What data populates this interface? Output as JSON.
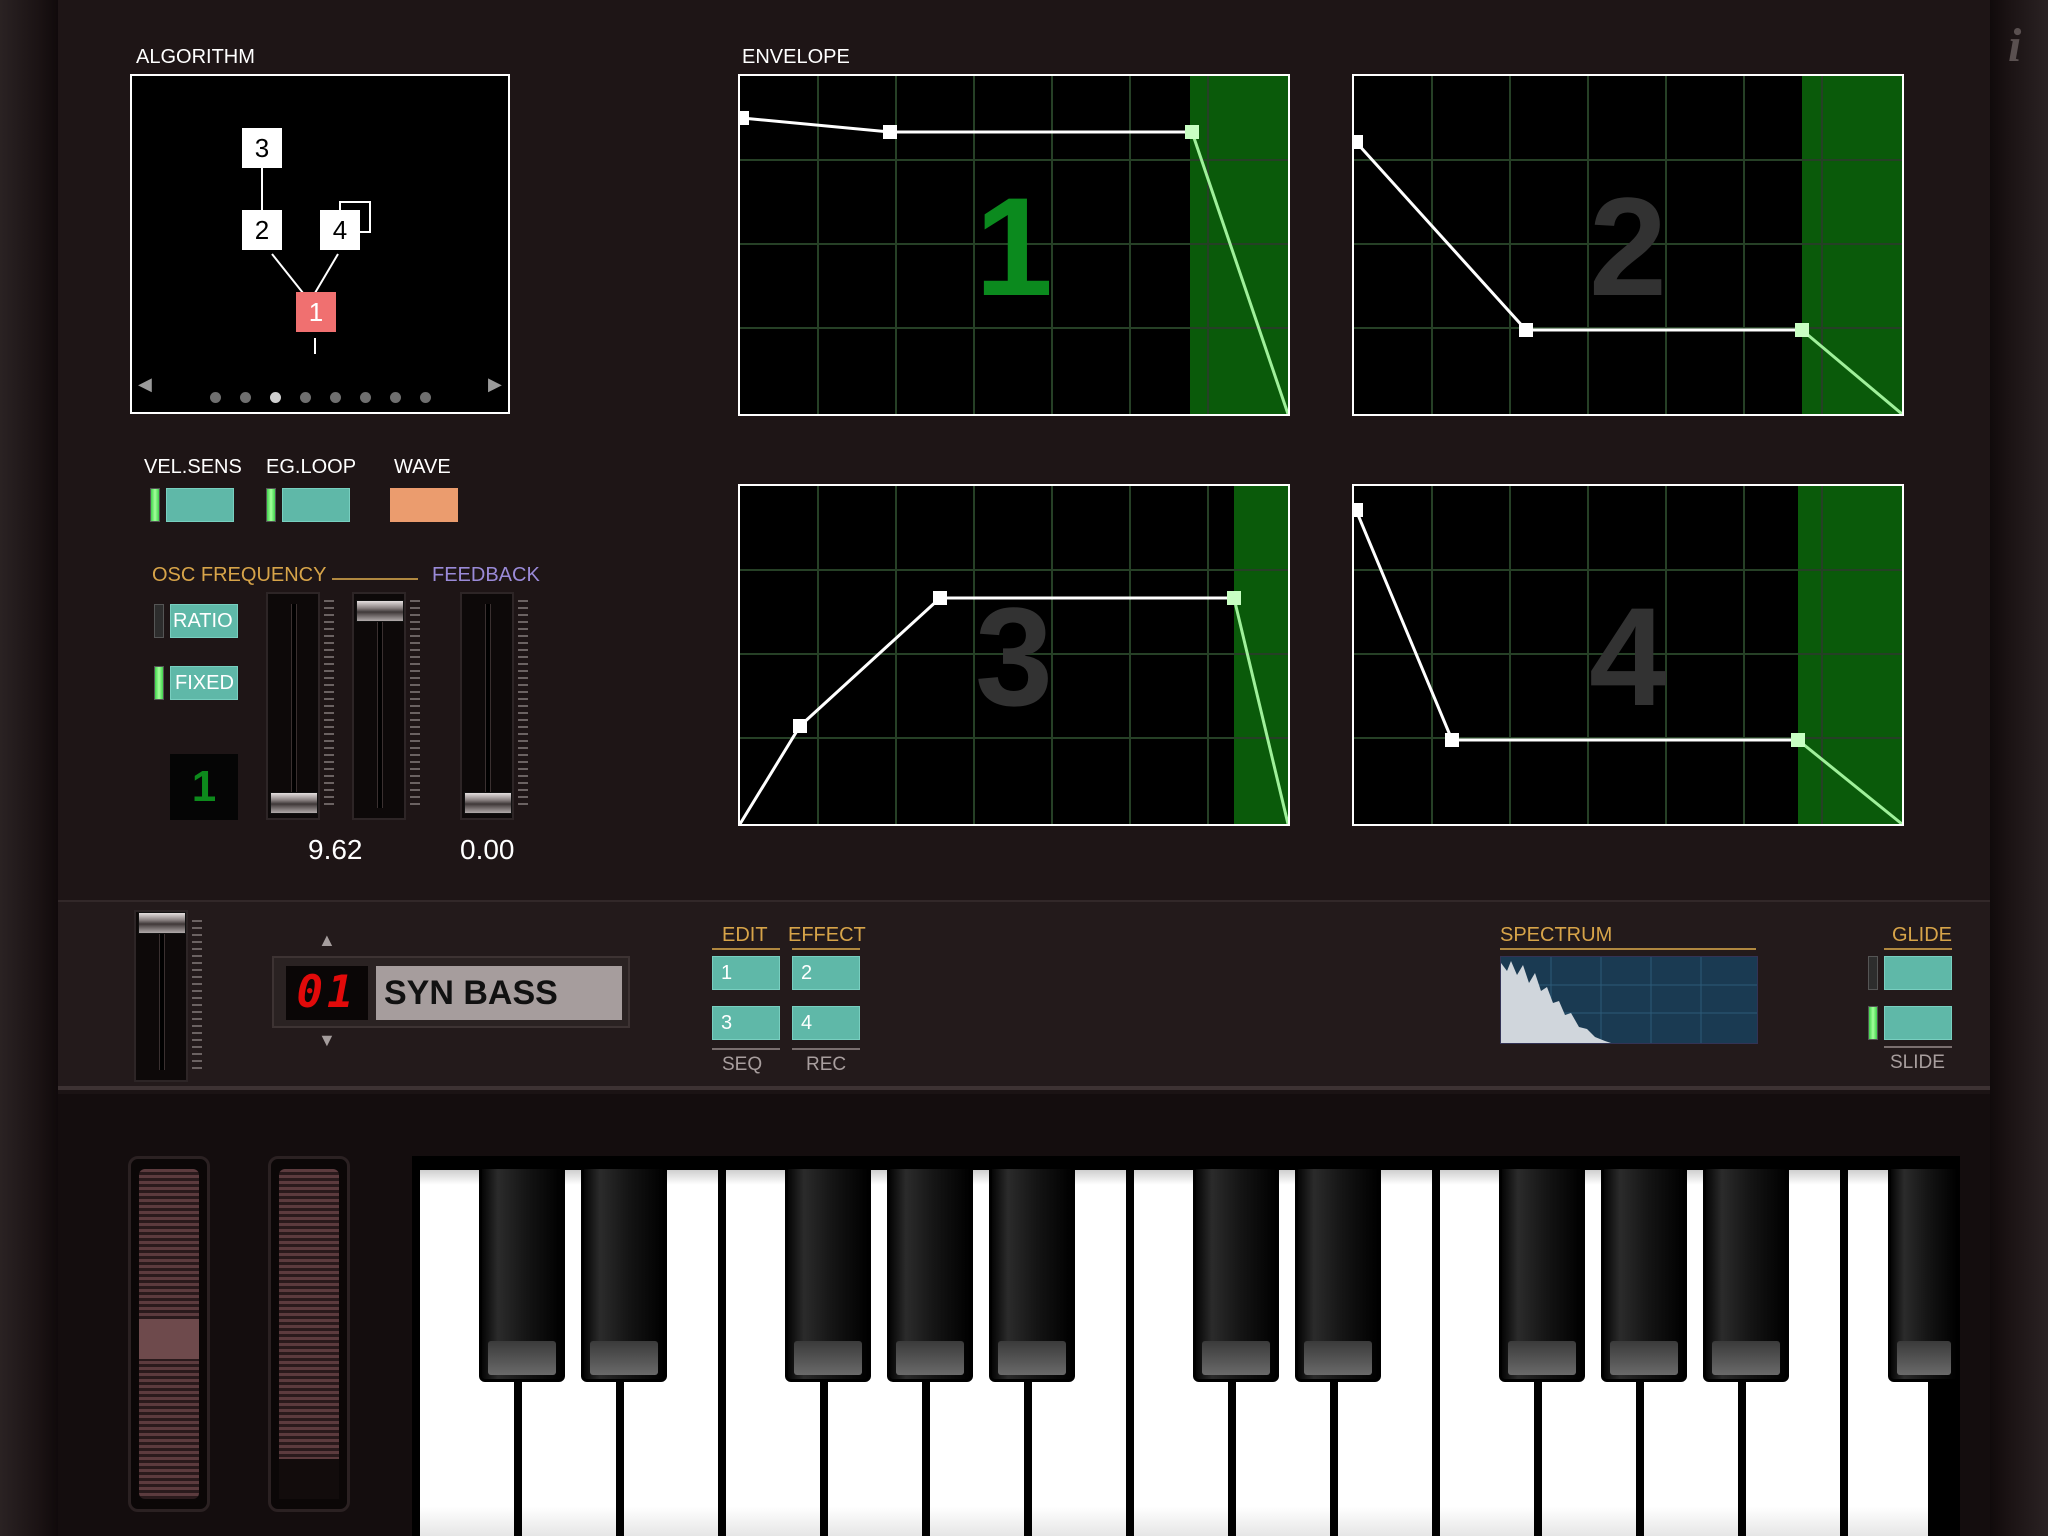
{
  "algorithm": {
    "label": "ALGORITHM",
    "operators": [
      "3",
      "2",
      "4",
      "1"
    ],
    "page_dots": 8,
    "active_page": 3,
    "prev_arrow": "◀",
    "next_arrow": "▶"
  },
  "envelope": {
    "label": "ENVELOPE",
    "panels": [
      {
        "number": "1",
        "active": true
      },
      {
        "number": "2",
        "active": false
      },
      {
        "number": "3",
        "active": false
      },
      {
        "number": "4",
        "active": false
      }
    ]
  },
  "operator_controls": {
    "vel_sens_label": "VEL.SENS",
    "eg_loop_label": "EG.LOOP",
    "wave_label": "WAVE",
    "vel_sens_on": true,
    "eg_loop_on": true,
    "wave_color": "#eb9c6e"
  },
  "osc": {
    "frequency_label": "OSC FREQUENCY",
    "feedback_label": "FEEDBACK",
    "ratio_label": "RATIO",
    "fixed_label": "FIXED",
    "ratio_on": false,
    "fixed_on": true,
    "selected_operator": "1",
    "frequency_value": "9.62",
    "feedback_value": "0.00"
  },
  "preset": {
    "number": "01",
    "name": "SYN BASS",
    "up_arrow": "▲",
    "down_arrow": "▼"
  },
  "modes": {
    "edit_label": "EDIT",
    "effect_label": "EFFECT",
    "seq_label": "SEQ",
    "rec_label": "REC",
    "buttons": [
      "1",
      "2",
      "3",
      "4"
    ]
  },
  "spectrum": {
    "label": "SPECTRUM"
  },
  "glide": {
    "glide_label": "GLIDE",
    "slide_label": "SLIDE",
    "glide_on": false,
    "slide_on": true
  },
  "colors": {
    "accent_teal": "#5fb8a8",
    "label_gold": "#d7a449",
    "label_purple": "#9a8ad8",
    "envelope_release": "#0a5a0a",
    "carrier_operator": "#f07070",
    "led_on": "#3fd34c",
    "preset_led": "#e20a0a"
  },
  "icons": {
    "info": "i"
  }
}
